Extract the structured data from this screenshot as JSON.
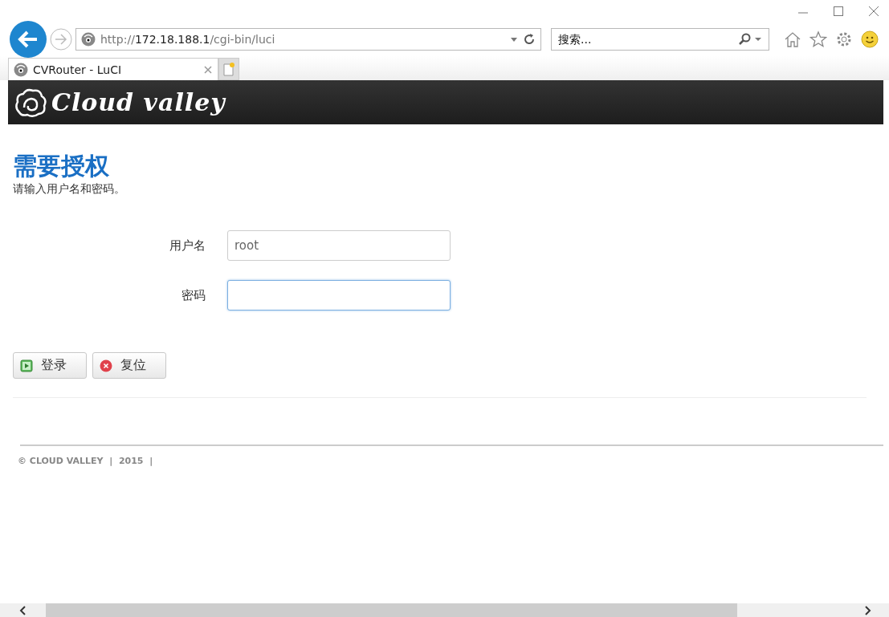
{
  "browser": {
    "address": "http://**172.18.188.1**/cgi-bin/luci",
    "search": {
      "placeholder": "搜索..."
    },
    "tabs": [
      {
        "title": "CVRouter - LuCI",
        "selected": true
      }
    ]
  },
  "header": {
    "logo": "Cloud valley"
  },
  "login": {
    "title": "需要授权",
    "subtitle": "请输入用户名和密码。",
    "fields": [
      {
        "label": "用户名",
        "value": "root",
        "kind": "text",
        "focused": false
      },
      {
        "label": "密码",
        "kind": "password",
        "focused": true
      }
    ],
    "buttons": [
      {
        "label": "登录",
        "kind": "submit"
      },
      {
        "label": "复位",
        "kind": "reset"
      }
    ]
  },
  "footer": {
    "text": "© CLOUD VALLEY  |  2015  |"
  }
}
